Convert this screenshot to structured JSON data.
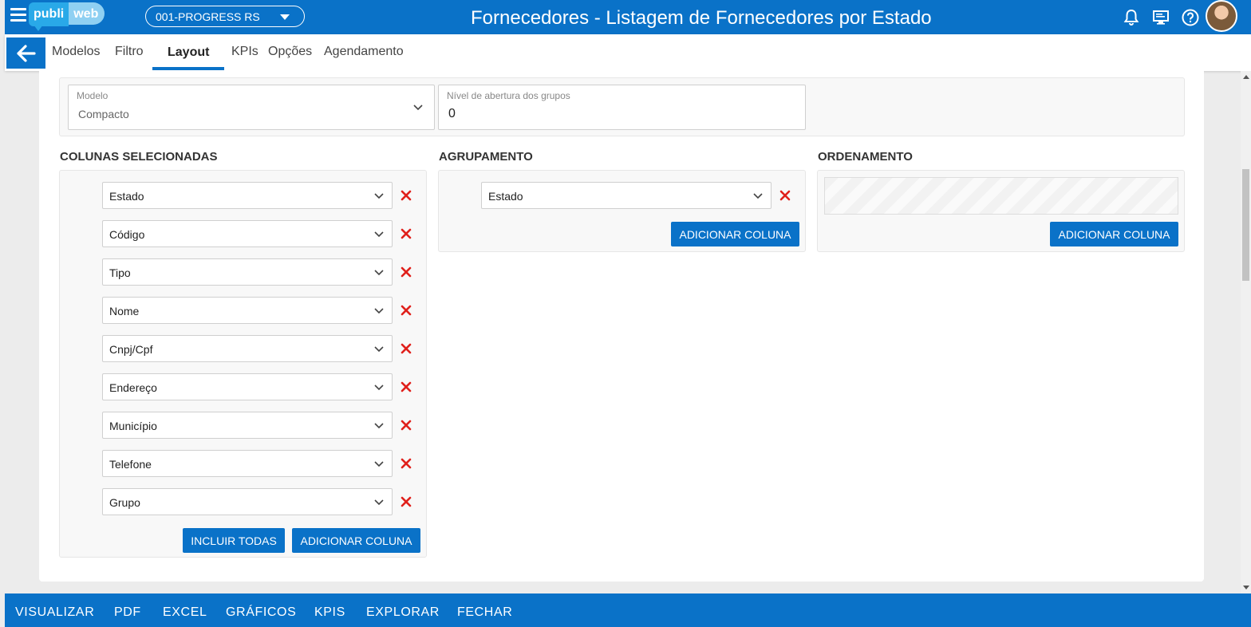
{
  "header": {
    "logo_left": "publi",
    "logo_right": "web",
    "company": "001-PROGRESS RS",
    "title": "Fornecedores - Listagem de Fornecedores por Estado",
    "icons": [
      "menu-icon",
      "bell-icon",
      "monitor-icon",
      "help-icon"
    ]
  },
  "tabs": [
    {
      "label": "Modelos"
    },
    {
      "label": "Filtro"
    },
    {
      "label": "Layout",
      "active": true
    },
    {
      "label": "KPIs"
    },
    {
      "label": "Opções"
    },
    {
      "label": "Agendamento"
    }
  ],
  "model": {
    "label": "Modelo",
    "value": "Compacto",
    "level_label": "Nível de abertura dos grupos",
    "level_value": "0"
  },
  "columns": {
    "title": "COLUNAS SELECIONADAS",
    "items": [
      "Estado",
      "Código",
      "Tipo",
      "Nome",
      "Cnpj/Cpf",
      "Endereço",
      "Município",
      "Telefone",
      "Grupo"
    ],
    "include_all": "INCLUIR TODAS",
    "add": "ADICIONAR COLUNA"
  },
  "grouping": {
    "title": "AGRUPAMENTO",
    "items": [
      "Estado"
    ],
    "add": "ADICIONAR COLUNA"
  },
  "ordering": {
    "title": "ORDENAMENTO",
    "add": "ADICIONAR COLUNA"
  },
  "bottom": [
    "VISUALIZAR",
    "PDF",
    "EXCEL",
    "GRÁFICOS",
    "KPIS",
    "EXPLORAR",
    "FECHAR"
  ],
  "colors": {
    "primary": "#0a72c8",
    "remove": "#e0201b"
  }
}
